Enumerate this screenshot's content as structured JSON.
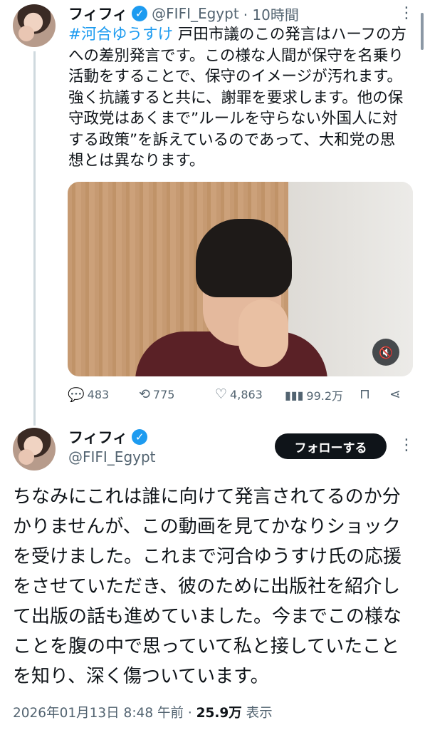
{
  "tweet1": {
    "name": "フィフィ",
    "handle": "@FIFI_Egypt",
    "time": "· 10時間",
    "hashtag": "#河合ゆうすけ",
    "text": " 戸田市議のこの発言はハーフの方への差別発言です。この様な人間が保守を名乗り活動をすることで、保守のイメージが汚れます。強く抗議すると共に、謝罪を要求します。他の保守政党はあくまで”ルールを守らない外国人に対する政策”を訴えているのであって、大和党の思想とは異なります。",
    "replies": "483",
    "retweets": "775",
    "likes": "4,863",
    "views": "99.2万"
  },
  "tweet2": {
    "name": "フィフィ",
    "handle": "@FIFI_Egypt",
    "follow_label": "フォローする",
    "text": "ちなみにこれは誰に向けて発言されてるのか分かりませんが、この動画を見てかなりショックを受けました。これまで河合ゆうすけ氏の応援をさせていただき、彼のために出版社を紹介して出版の話も進めていました。今までこの様なことを腹の中で思っていて私と接していたことを知り、深く傷ついています。",
    "timestamp": "2026年01月13日 8:48 午前 · ",
    "views_count": "25.9万",
    "views_label": " 表示"
  },
  "icons": {
    "reply": "reply-icon",
    "retweet": "retweet-icon",
    "like": "heart-icon",
    "views": "views-chart-icon",
    "bookmark": "bookmark-icon",
    "share": "share-icon",
    "mute": "mute-icon"
  },
  "colors": {
    "accent": "#1d9bf0",
    "text": "#0f1419",
    "muted": "#536471"
  }
}
